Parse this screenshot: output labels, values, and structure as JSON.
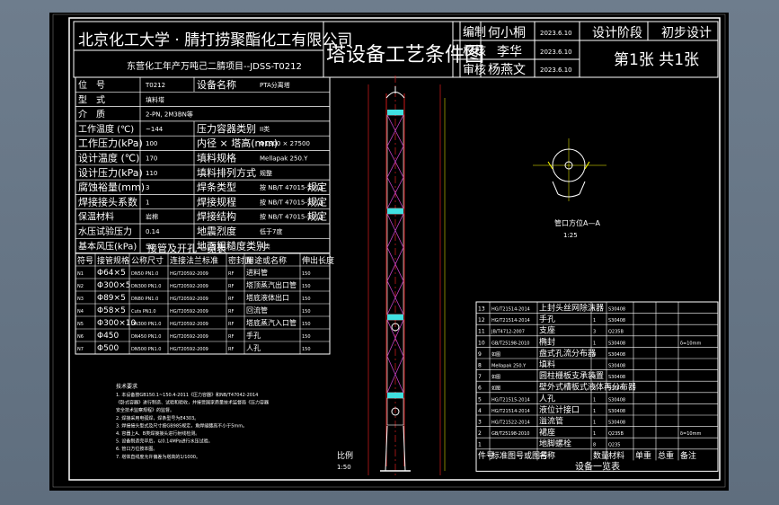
{
  "title_block": {
    "company": "北京化工大学 · 腈打捞聚酯化工有限公司",
    "project": "东营化工年产万吨己二腈项目--JDSS-T0212",
    "drawing_title": "塔设备工艺条件图",
    "role_labels": [
      "编制",
      "校核",
      "审核"
    ],
    "names": [
      "何小桐",
      "李华",
      "杨燕文"
    ],
    "dates": [
      "2023.6.10",
      "2023.6.10",
      "2023.6.10"
    ],
    "stage_label": "设计阶段",
    "stage_value": "初步设计",
    "sheet_info": "第1张  共1张"
  },
  "spec_table": {
    "rows": [
      {
        "label": "位　号",
        "value": "T0212",
        "label2": "设备名称",
        "value2": "PTA分离塔"
      },
      {
        "label": "型　式",
        "value": "填料塔"
      },
      {
        "label": "介　质",
        "value": "2-PN, 2M3BN等"
      },
      {
        "label": "工作温度 (℃)",
        "value": "~144",
        "label2": "压力容器类别",
        "value2": "II类"
      },
      {
        "label": "工作压力(kPa)",
        "value": "100",
        "label2": "内径 × 塔高(mm)",
        "value2": "Φ1300 × 27500"
      },
      {
        "label": "设计温度 (℃)",
        "value": "170",
        "label2": "填料规格",
        "value2": "Mellapak 250.Y"
      },
      {
        "label": "设计压力(kPa)",
        "value": "110",
        "label2": "填料排列方式",
        "value2": "规整"
      },
      {
        "label": "腐蚀裕量(mm)",
        "value": "3",
        "label2": "焊条类型",
        "value2": "按 NB/T 47015-2011",
        "value3": "规定"
      },
      {
        "label": "焊接接头系数",
        "value": "1",
        "label2": "焊接规程",
        "value2": "按 NB/T 47015-2011",
        "value3": "规定"
      },
      {
        "label": "保温材料",
        "value": "岩棉",
        "label2": "焊接结构",
        "value2": "按 NB/T 47015-2011",
        "value3": "规定"
      },
      {
        "label": "水压试验压力",
        "value": "0.14",
        "label2": "地震烈度",
        "value2": "低于7度"
      },
      {
        "label": "基本风压(kPa)",
        "value": "50",
        "label2": "地面粗糙度类别",
        "value2": "A类"
      }
    ]
  },
  "nozzle_table": {
    "title": "接管及开孔一览表",
    "headers": [
      "符号",
      "接管规格",
      "公称尺寸",
      "连接法兰标准",
      "密封面",
      "用途或名称",
      "伸出长度"
    ],
    "rows": [
      [
        "N1",
        "Φ64×5",
        "DN50 PN1.0",
        "HG/T20592-2009",
        "RF",
        "进料管",
        "150"
      ],
      [
        "N2",
        "Φ300×5",
        "DN300 PN1.0",
        "HG/T20592-2009",
        "RF",
        "塔顶蒸汽出口管",
        "150"
      ],
      [
        "N3",
        "Φ89×5",
        "DN80 PN1.0",
        "HG/T20592-2009",
        "RF",
        "塔底液体出口",
        "150"
      ],
      [
        "N4",
        "Φ58×5",
        "Cuts PN1.0",
        "HG/T20592-2009",
        "RF",
        "回流管",
        "150"
      ],
      [
        "N5",
        "Φ300×10",
        "DN300 PN1.0",
        "HG/T20592-2009",
        "RF",
        "塔底蒸汽入口管",
        "150"
      ],
      [
        "N6",
        "Φ450",
        "DN450 PN1.0",
        "HG/T20592-2009",
        "RF",
        "手孔",
        "150"
      ],
      [
        "N7",
        "Φ500",
        "DN500 PN1.0",
        "HG/T20592-2009",
        "RF",
        "人孔",
        "150"
      ]
    ]
  },
  "notes": {
    "title": "技术要求",
    "lines": [
      "1. 本设备按GB150.1~150.4-2011《压力容器》和NB/T47042-2014",
      "   《卧式容器》进行制造、试验和验收，并接受国家质量技术监督局《压力容器",
      "   安全技术监察规程》的监督。",
      "2. 焊接采用电弧焊，焊条型号为E4303。",
      "3. 焊接接头型式及尺寸按GB985规定，角焊缝腰高不小于5mm。",
      "4. 容器上A、B类焊接接头进行射线检测。",
      "5. 设备制造完毕后，以0.14MPa进行水压试验。",
      "6. 管口方位按本图。",
      "7. 塔体直线度允许偏差为塔高的1/1000。"
    ]
  },
  "section_view": {
    "caption": "管口方位A—A",
    "scale": "1:25"
  },
  "main_view": {
    "caption": "比例",
    "scale": "1:50"
  },
  "parts_list": {
    "title": "设备一览表",
    "headers": [
      "件号",
      "标准图号或图号",
      "名称",
      "数量",
      "材料",
      "单重",
      "总重",
      "备注"
    ],
    "rows": [
      [
        "13",
        "HG/T21514-2014",
        "上封头丝网除沫器",
        "1",
        "S30408",
        "",
        "",
        ""
      ],
      [
        "12",
        "HG/T21514-2014",
        "手孔",
        "1",
        "S30408",
        "",
        "",
        ""
      ],
      [
        "11",
        "JB/T4712-2007",
        "支座",
        "3",
        "Q235B",
        "",
        "",
        ""
      ],
      [
        "10",
        "GB/T25198-2010",
        "椭封",
        "1",
        "S30408",
        "",
        "",
        "δ=10mm"
      ],
      [
        "9",
        "如图",
        "盘式孔流分布器",
        "3",
        "S30408",
        "",
        "",
        ""
      ],
      [
        "8",
        "Mellapak 250.Y",
        "填料",
        "",
        "S30408",
        "",
        "",
        ""
      ],
      [
        "7",
        "如图",
        "圆柱栅板支承装置",
        "3",
        "S30408",
        "",
        "",
        ""
      ],
      [
        "6",
        "如图",
        "壁外式槽板式液体再分布器",
        "3",
        "S30408",
        "",
        "",
        ""
      ],
      [
        "5",
        "HG/T21515-2014",
        "人孔",
        "1",
        "S30408",
        "",
        "",
        ""
      ],
      [
        "4",
        "HG/T21514-2014",
        "液位计接口",
        "1",
        "S30408",
        "",
        "",
        ""
      ],
      [
        "3",
        "HG/T21522-2014",
        "溢流管",
        "1",
        "S30408",
        "",
        "",
        ""
      ],
      [
        "2",
        "GB/T25198-2010",
        "裙座",
        "1",
        "Q235B",
        "",
        "",
        "δ=10mm"
      ],
      [
        "1",
        "",
        "地脚螺栓",
        "8",
        "Q235",
        "",
        "",
        ""
      ]
    ]
  },
  "colors": {
    "background": "#000000",
    "line": "#ffffff",
    "dim": "#ffff00",
    "red": "#ff2020",
    "magenta": "#c040c0",
    "cyan": "#40e0e0",
    "blue": "#2040ff"
  }
}
